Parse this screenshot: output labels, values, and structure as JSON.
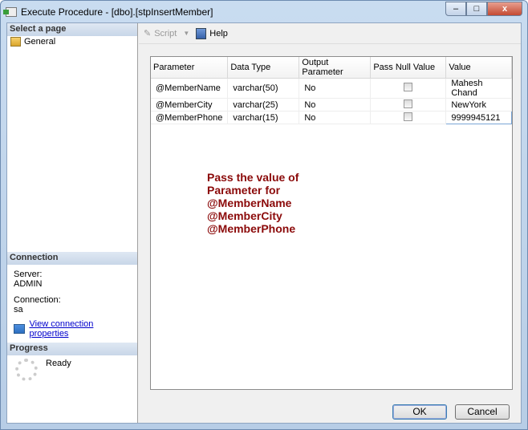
{
  "window": {
    "title": "Execute Procedure - [dbo].[stpInsertMember]",
    "minimize": "–",
    "maximize": "□",
    "close": "x"
  },
  "left": {
    "select_page": "Select a page",
    "pages": [
      {
        "label": "General"
      }
    ],
    "connection": {
      "header": "Connection",
      "server_label": "Server:",
      "server": "ADMIN",
      "connection_label": "Connection:",
      "connection": "sa",
      "link": "View connection properties"
    },
    "progress": {
      "header": "Progress",
      "status": "Ready"
    }
  },
  "toolbar": {
    "script": "Script",
    "help": "Help"
  },
  "grid": {
    "columns": [
      "Parameter",
      "Data Type",
      "Output Parameter",
      "Pass Null Value",
      "Value"
    ],
    "rows": [
      {
        "parameter": "@MemberName",
        "type": "varchar(50)",
        "output": "No",
        "pass_null": false,
        "value": "Mahesh Chand"
      },
      {
        "parameter": "@MemberCity",
        "type": "varchar(25)",
        "output": "No",
        "pass_null": false,
        "value": "NewYork"
      },
      {
        "parameter": "@MemberPhone",
        "type": "varchar(15)",
        "output": "No",
        "pass_null": false,
        "value": "9999945121"
      }
    ]
  },
  "annotation": [
    "Pass the value of",
    "Parameter for",
    "@MemberName",
    "@MemberCity",
    "@MemberPhone"
  ],
  "buttons": {
    "ok": "OK",
    "cancel": "Cancel"
  }
}
